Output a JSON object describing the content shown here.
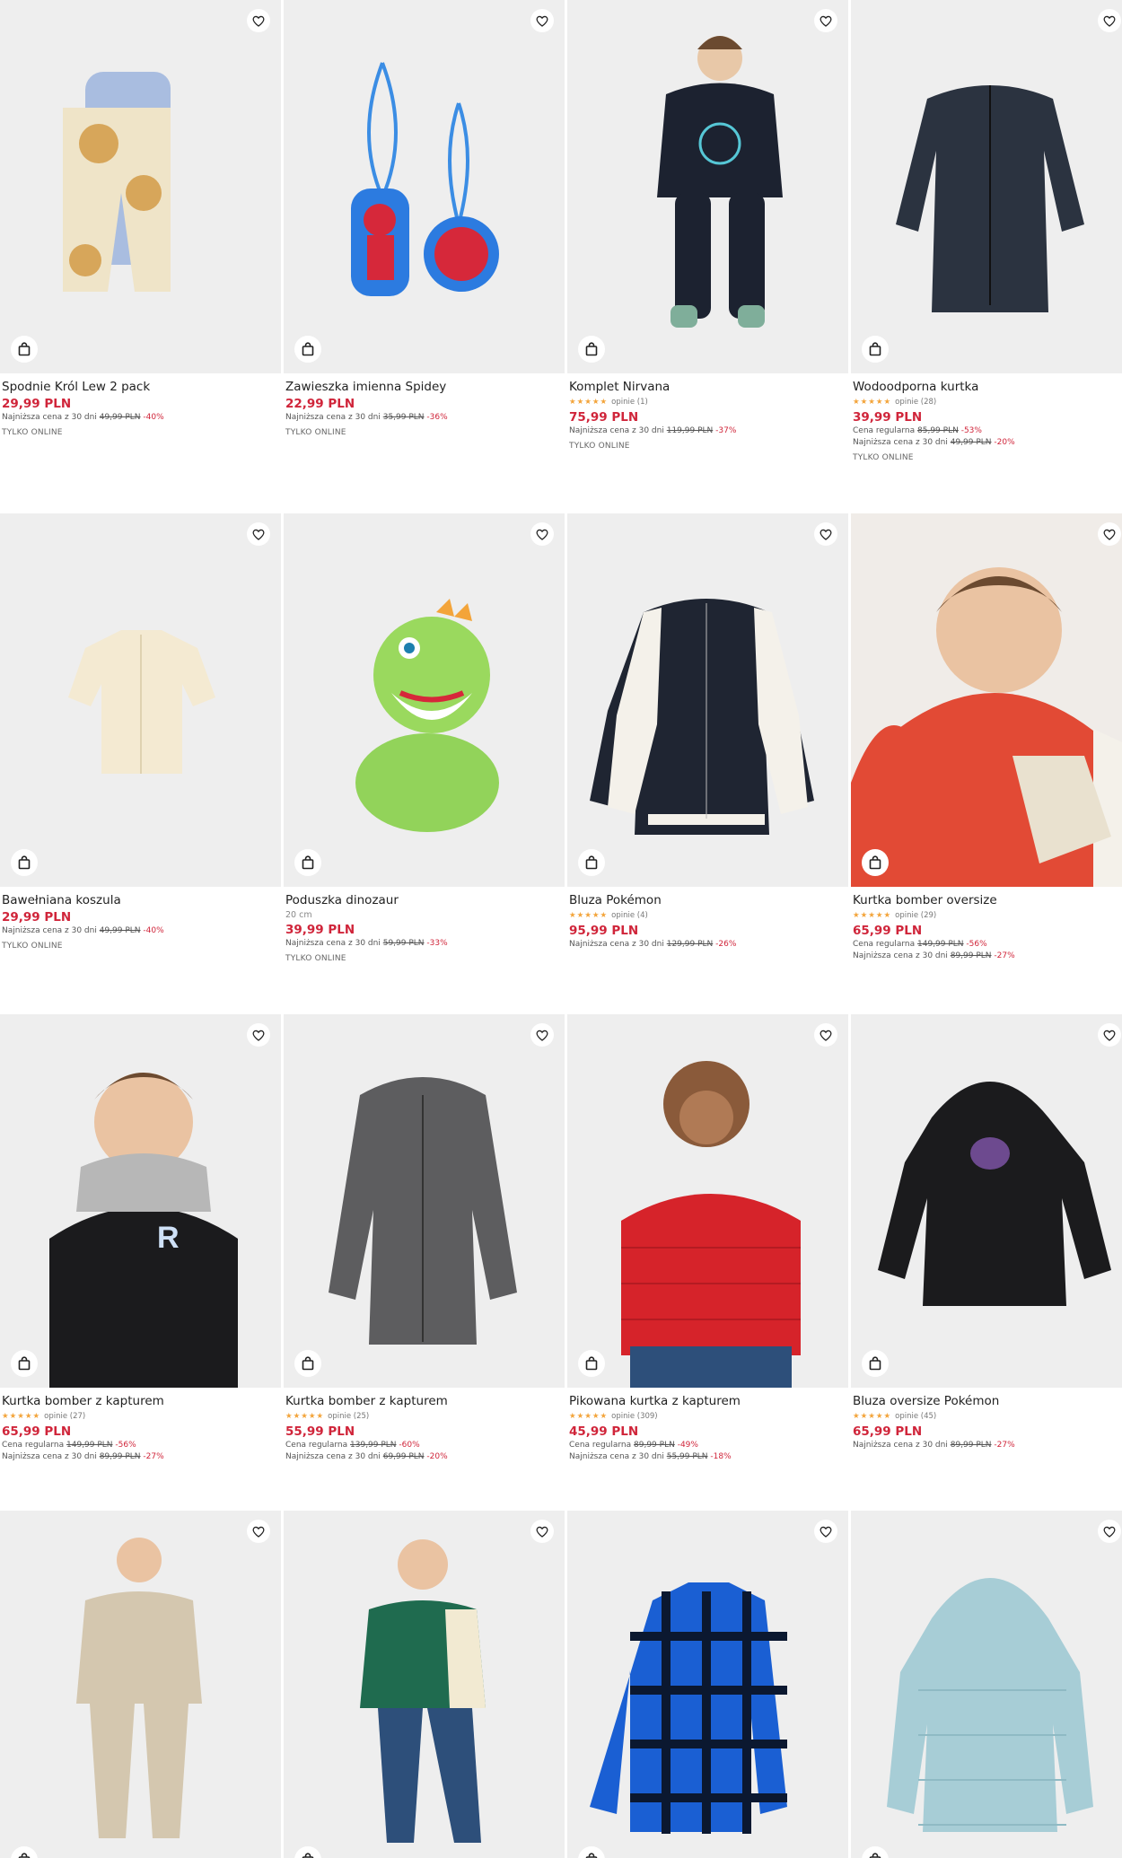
{
  "products": [
    {
      "name": "Spodnie Król Lew 2 pack",
      "price": "29,99 PLN",
      "lowest": {
        "label": "Najniższa cena z 30 dni",
        "old": "49,99 PLN",
        "pct": "-40%"
      },
      "online": "TYLKO ONLINE"
    },
    {
      "name": "Zawieszka imienna Spidey",
      "price": "22,99 PLN",
      "lowest": {
        "label": "Najniższa cena z 30 dni",
        "old": "35,99 PLN",
        "pct": "-36%"
      },
      "online": "TYLKO ONLINE"
    },
    {
      "name": "Komplet Nirvana",
      "rating": {
        "stars": 5,
        "label": "opinie (1)"
      },
      "price": "75,99 PLN",
      "lowest": {
        "label": "Najniższa cena z 30 dni",
        "old": "119,99 PLN",
        "pct": "-37%"
      },
      "online": "TYLKO ONLINE"
    },
    {
      "name": "Wodoodporna kurtka",
      "rating": {
        "stars": 5,
        "label": "opinie (28)"
      },
      "price": "39,99 PLN",
      "regular": {
        "label": "Cena regularna",
        "old": "85,99 PLN",
        "pct": "-53%"
      },
      "lowest": {
        "label": "Najniższa cena z 30 dni",
        "old": "49,99 PLN",
        "pct": "-20%"
      },
      "online": "TYLKO ONLINE"
    },
    {
      "name": "Bawełniana koszula",
      "price": "29,99 PLN",
      "lowest": {
        "label": "Najniższa cena z 30 dni",
        "old": "49,99 PLN",
        "pct": "-40%"
      },
      "online": "TYLKO ONLINE"
    },
    {
      "name": "Poduszka dinozaur",
      "subtitle": "20 cm",
      "price": "39,99 PLN",
      "lowest": {
        "label": "Najniższa cena z 30 dni",
        "old": "59,99 PLN",
        "pct": "-33%"
      },
      "online": "TYLKO ONLINE"
    },
    {
      "name": "Bluza Pokémon",
      "rating": {
        "stars": 4.5,
        "label": "opinie (4)"
      },
      "price": "95,99 PLN",
      "lowest": {
        "label": "Najniższa cena z 30 dni",
        "old": "129,99 PLN",
        "pct": "-26%"
      }
    },
    {
      "name": "Kurtka bomber oversize",
      "rating": {
        "stars": 5,
        "label": "opinie (29)"
      },
      "price": "65,99 PLN",
      "regular": {
        "label": "Cena regularna",
        "old": "149,99 PLN",
        "pct": "-56%"
      },
      "lowest": {
        "label": "Najniższa cena z 30 dni",
        "old": "89,99 PLN",
        "pct": "-27%"
      }
    },
    {
      "name": "Kurtka bomber z kapturem",
      "rating": {
        "stars": 5,
        "label": "opinie (27)"
      },
      "price": "65,99 PLN",
      "regular": {
        "label": "Cena regularna",
        "old": "149,99 PLN",
        "pct": "-56%"
      },
      "lowest": {
        "label": "Najniższa cena z 30 dni",
        "old": "89,99 PLN",
        "pct": "-27%"
      }
    },
    {
      "name": "Kurtka bomber z kapturem",
      "rating": {
        "stars": 5,
        "label": "opinie (25)"
      },
      "price": "55,99 PLN",
      "regular": {
        "label": "Cena regularna",
        "old": "139,99 PLN",
        "pct": "-60%"
      },
      "lowest": {
        "label": "Najniższa cena z 30 dni",
        "old": "69,99 PLN",
        "pct": "-20%"
      }
    },
    {
      "name": "Pikowana kurtka z kapturem",
      "rating": {
        "stars": 4.5,
        "label": "opinie (309)"
      },
      "price": "45,99 PLN",
      "regular": {
        "label": "Cena regularna",
        "old": "89,99 PLN",
        "pct": "-49%"
      },
      "lowest": {
        "label": "Najniższa cena z 30 dni",
        "old": "55,99 PLN",
        "pct": "-18%"
      }
    },
    {
      "name": "Bluza oversize Pokémon",
      "rating": {
        "stars": 5,
        "label": "opinie (45)"
      },
      "price": "65,99 PLN",
      "lowest": {
        "label": "Najniższa cena z 30 dni",
        "old": "89,99 PLN",
        "pct": "-27%"
      }
    },
    {
      "name": ""
    },
    {
      "name": ""
    },
    {
      "name": ""
    },
    {
      "name": ""
    }
  ],
  "icons": {
    "favorite": "heart-icon",
    "cart": "shopping-bag-icon",
    "star": "star-icon"
  },
  "colors": {
    "sale": "#d0253a",
    "star": "#f3a43a",
    "image_bg": "#eeeeee"
  }
}
